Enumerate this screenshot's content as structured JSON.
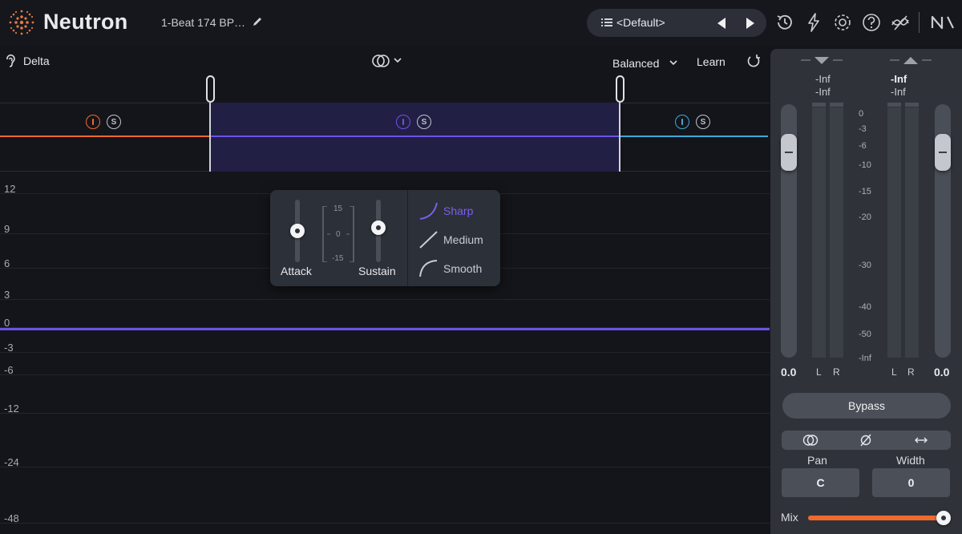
{
  "app": {
    "name": "Neutron",
    "logo_icon": "neutron-logo-icon"
  },
  "header": {
    "preset_file": "1-Beat 174 BP…",
    "preset_name": "<Default>",
    "icons": [
      "pencil-icon",
      "list-icon",
      "prev-arrow-icon",
      "next-arrow-icon",
      "history-icon",
      "lightning-icon",
      "gear-icon",
      "help-icon",
      "assistant-icon",
      "ni-logo-icon"
    ]
  },
  "controls": {
    "delta_label": "Delta",
    "mode_label": "Balanced",
    "learn_label": "Learn"
  },
  "bands": [
    {
      "color": "#f06a2d",
      "power_icon": "power-icon",
      "solo_label": "S"
    },
    {
      "color": "#6b52e6",
      "power_icon": "power-icon",
      "solo_label": "S"
    },
    {
      "color": "#3fa8d9",
      "power_icon": "power-icon",
      "solo_label": "S"
    }
  ],
  "graph": {
    "y_labels": [
      "12",
      "9",
      "6",
      "3",
      "0",
      "-3",
      "-6",
      "-12",
      "-24",
      "-48"
    ],
    "line_color": "#6b52e6"
  },
  "transient_popup": {
    "attack_label": "Attack",
    "sustain_label": "Sustain",
    "scale": [
      "15",
      "0",
      "-15"
    ],
    "attack_value": 0.5,
    "sustain_value": 0.5,
    "curves": [
      {
        "label": "Sharp",
        "selected": true
      },
      {
        "label": "Medium",
        "selected": false
      },
      {
        "label": "Smooth",
        "selected": false
      }
    ]
  },
  "io_panel": {
    "input": {
      "peak": "-Inf",
      "rms": "-Inf",
      "gain": "0.0"
    },
    "output": {
      "peak": "-Inf",
      "rms": "-Inf",
      "gain": "0.0"
    },
    "meter_scale": [
      "0",
      "-3",
      "-6",
      "-10",
      "-15",
      "-20",
      "-30",
      "-40",
      "-50",
      "-Inf"
    ],
    "channel_labels": [
      "L",
      "R"
    ],
    "bypass_label": "Bypass",
    "mode_icons": [
      "stereo-link-icon",
      "phase-invert-icon",
      "swap-channels-icon"
    ],
    "pan_label": "Pan",
    "pan_value": "C",
    "width_label": "Width",
    "width_value": "0",
    "mix_label": "Mix",
    "mix_value": 1.0,
    "accent_color": "#f06a2d"
  }
}
